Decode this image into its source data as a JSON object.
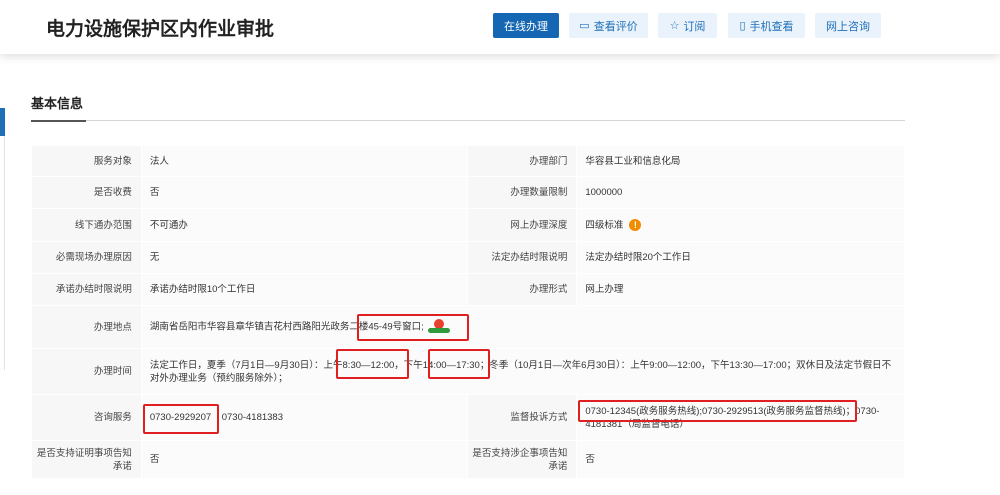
{
  "header": {
    "title": "电力设施保护区内作业审批",
    "buttons": {
      "online": "在线办理",
      "review": "查看评价",
      "subscribe": "订阅",
      "mobile": "手机查看",
      "consult": "网上咨询"
    },
    "icons": {
      "review": "comment-icon",
      "subscribe": "star-icon",
      "mobile": "phone-icon"
    }
  },
  "section": {
    "title": "基本信息"
  },
  "rows": {
    "service_target_label": "服务对象",
    "service_target": "法人",
    "dept_label": "办理部门",
    "dept": "华容县工业和信息化局",
    "fee_label": "是否收费",
    "fee": "否",
    "limit_label": "办理数量限制",
    "limit": "1000000",
    "offline_label": "线下通办范围",
    "offline": "不可通办",
    "depth_label": "网上办理深度",
    "depth": "四级标准",
    "onsite_label": "必需现场办理原因",
    "onsite": "无",
    "legal_time_label": "法定办结时限说明",
    "legal_time": "法定办结时限20个工作日",
    "promise_time_label": "承诺办结时限说明",
    "promise_time": "承诺办结时限10个工作日",
    "form_label": "办理形式",
    "form": "网上办理",
    "address_label": "办理地点",
    "address": "湖南省岳阳市华容县章华镇吉花村西路阳光政务二楼45-49号窗口;",
    "hours_label": "办理时间",
    "hours": "法定工作日，夏季（7月1日—9月30日）：上午8:30—12:00，下午14:00—17:30；冬季（10月1日—次年6月30日）：上午9:00—12:00，下午13:30—17:00；双休日及法定节假日不对外办理业务（预约服务除外）；",
    "consult_label": "咨询服务",
    "consult_phone1": "0730-2929207",
    "consult_phone2": "0730-4181383",
    "complaint_label": "监督投诉方式",
    "complaint": "0730-12345(政务服务热线);0730-2929513(政务服务监督热线)；0730-4181381（局监督电话）",
    "cert_label": "是否支持证明事项告知承诺",
    "cert": "否",
    "enterprise_label": "是否支持涉企事项告知承诺",
    "enterprise": "否"
  },
  "colors": {
    "primary": "#1567b3",
    "highlight": "#e02020",
    "warning": "#f08c00"
  }
}
